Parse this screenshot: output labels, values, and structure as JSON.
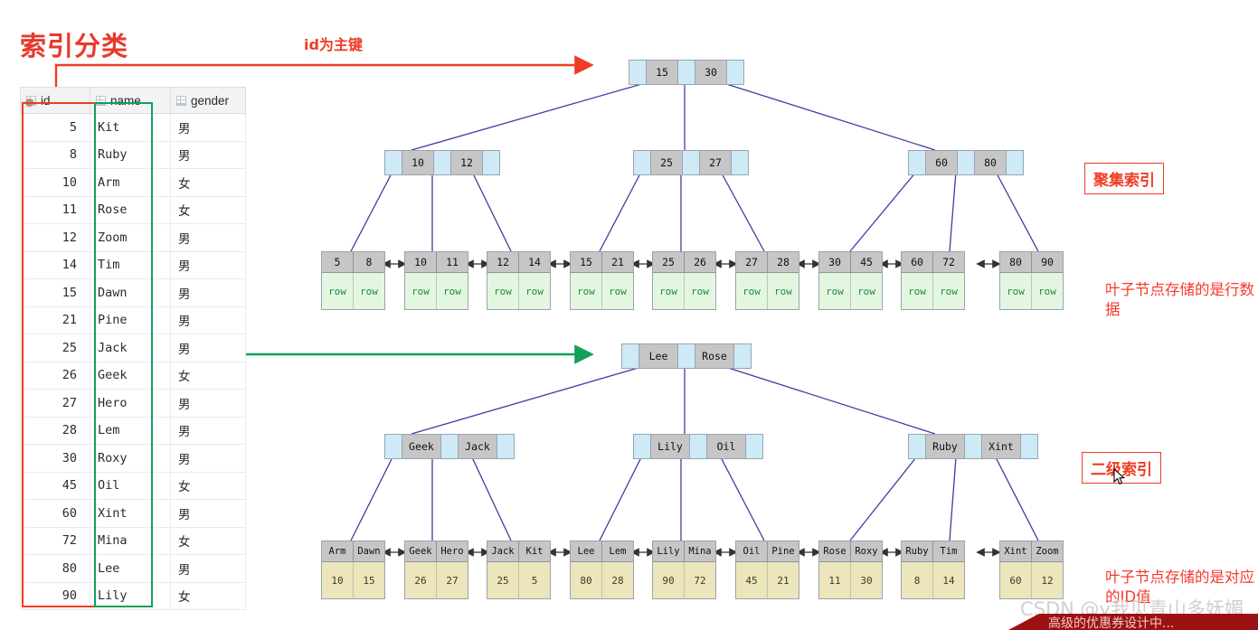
{
  "page": {
    "title": "索引分类",
    "watermark": "CSDN @y我见青山多妩媚",
    "banner_text": "高级的优惠券设计中..."
  },
  "table": {
    "columns": [
      {
        "label": "id",
        "icon": "key-column-icon"
      },
      {
        "label": "name",
        "icon": "grid-column-icon"
      },
      {
        "label": "gender",
        "icon": "grid-column-icon"
      }
    ],
    "rows": [
      {
        "id": "5",
        "name": "Kit",
        "gender": "男"
      },
      {
        "id": "8",
        "name": "Ruby",
        "gender": "男"
      },
      {
        "id": "10",
        "name": "Arm",
        "gender": "女"
      },
      {
        "id": "11",
        "name": "Rose",
        "gender": "女"
      },
      {
        "id": "12",
        "name": "Zoom",
        "gender": "男"
      },
      {
        "id": "14",
        "name": "Tim",
        "gender": "男"
      },
      {
        "id": "15",
        "name": "Dawn",
        "gender": "男"
      },
      {
        "id": "21",
        "name": "Pine",
        "gender": "男"
      },
      {
        "id": "25",
        "name": "Jack",
        "gender": "男"
      },
      {
        "id": "26",
        "name": "Geek",
        "gender": "女"
      },
      {
        "id": "27",
        "name": "Hero",
        "gender": "男"
      },
      {
        "id": "28",
        "name": "Lem",
        "gender": "男"
      },
      {
        "id": "30",
        "name": "Roxy",
        "gender": "男"
      },
      {
        "id": "45",
        "name": "Oil",
        "gender": "女"
      },
      {
        "id": "60",
        "name": "Xint",
        "gender": "男"
      },
      {
        "id": "72",
        "name": "Mina",
        "gender": "女"
      },
      {
        "id": "80",
        "name": "Lee",
        "gender": "男"
      },
      {
        "id": "90",
        "name": "Lily",
        "gender": "女"
      }
    ]
  },
  "annotations": {
    "primary_key_arrow": "id为主键",
    "clustered_index": "聚集索引",
    "clustered_leaf_note": "叶子节点存储的是行数据",
    "secondary_index": "二级索引",
    "secondary_leaf_note": "叶子节点存储的是对应的ID值"
  },
  "colors": {
    "title": "#e8392c",
    "annotation_red": "#f03c22",
    "highlight_green": "#12a05a",
    "node_pointer": "#cfeaf7",
    "node_key": "#c6c6c6",
    "clustered_leaf_body": "#e3f7e0",
    "secondary_leaf_body": "#ede5bb",
    "edge": "#3b3fa0"
  },
  "clustered_tree": {
    "name": "聚集索引",
    "root": {
      "keys": [
        "15",
        "30"
      ]
    },
    "internal": [
      {
        "keys": [
          "10",
          "12"
        ]
      },
      {
        "keys": [
          "25",
          "27"
        ]
      },
      {
        "keys": [
          "60",
          "80"
        ]
      }
    ],
    "leaves": [
      {
        "keys": [
          "5",
          "8"
        ],
        "values": [
          "row",
          "row"
        ]
      },
      {
        "keys": [
          "10",
          "11"
        ],
        "values": [
          "row",
          "row"
        ]
      },
      {
        "keys": [
          "12",
          "14"
        ],
        "values": [
          "row",
          "row"
        ]
      },
      {
        "keys": [
          "15",
          "21"
        ],
        "values": [
          "row",
          "row"
        ]
      },
      {
        "keys": [
          "25",
          "26"
        ],
        "values": [
          "row",
          "row"
        ]
      },
      {
        "keys": [
          "27",
          "28"
        ],
        "values": [
          "row",
          "row"
        ]
      },
      {
        "keys": [
          "30",
          "45"
        ],
        "values": [
          "row",
          "row"
        ]
      },
      {
        "keys": [
          "60",
          "72"
        ],
        "values": [
          "row",
          "row"
        ]
      },
      {
        "keys": [
          "80",
          "90"
        ],
        "values": [
          "row",
          "row"
        ]
      }
    ]
  },
  "secondary_tree": {
    "name": "二级索引",
    "root": {
      "keys": [
        "Lee",
        "Rose"
      ]
    },
    "internal": [
      {
        "keys": [
          "Geek",
          "Jack"
        ]
      },
      {
        "keys": [
          "Lily",
          "Oil"
        ]
      },
      {
        "keys": [
          "Ruby",
          "Xint"
        ]
      }
    ],
    "leaves": [
      {
        "keys": [
          "Arm",
          "Dawn"
        ],
        "values": [
          "10",
          "15"
        ]
      },
      {
        "keys": [
          "Geek",
          "Hero"
        ],
        "values": [
          "26",
          "27"
        ]
      },
      {
        "keys": [
          "Jack",
          "Kit"
        ],
        "values": [
          "25",
          "5"
        ]
      },
      {
        "keys": [
          "Lee",
          "Lem"
        ],
        "values": [
          "80",
          "28"
        ]
      },
      {
        "keys": [
          "Lily",
          "Mina"
        ],
        "values": [
          "90",
          "72"
        ]
      },
      {
        "keys": [
          "Oil",
          "Pine"
        ],
        "values": [
          "45",
          "21"
        ]
      },
      {
        "keys": [
          "Rose",
          "Roxy"
        ],
        "values": [
          "11",
          "30"
        ]
      },
      {
        "keys": [
          "Ruby",
          "Tim"
        ],
        "values": [
          "8",
          "14"
        ]
      },
      {
        "keys": [
          "Xint",
          "Zoom"
        ],
        "values": [
          "60",
          "12"
        ]
      }
    ]
  }
}
